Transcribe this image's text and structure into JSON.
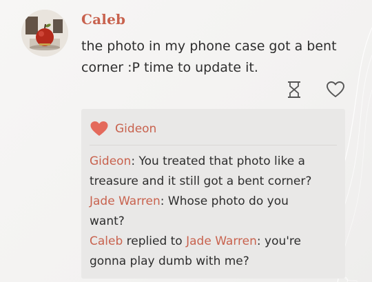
{
  "post": {
    "author": "Caleb",
    "text": "the photo in my phone case got a bent corner :P time to update it.",
    "avatar_icon": "apple-photo-avatar",
    "actions": {
      "hourglass_icon": "hourglass-icon",
      "like_icon": "heart-outline-icon"
    }
  },
  "likes": {
    "icon": "heart-filled-icon",
    "users": "Gideon"
  },
  "comments": [
    {
      "author": "Gideon",
      "text": ": You treated that photo like a treasure and it still got a bent corner?"
    },
    {
      "author": "Jade Warren",
      "text": ": Whose photo do you want?"
    },
    {
      "author": "Caleb",
      "replied_to_text": " replied to ",
      "reply_to": "Jade Warren",
      "text": ": you're gonna play dumb with me?"
    }
  ],
  "colors": {
    "name_accent": "#c8624e",
    "heart": "#e46a5c",
    "text": "#2d2d2d",
    "panel_bg": "#e9e8e7",
    "page_bg": "#f4f3f2"
  }
}
